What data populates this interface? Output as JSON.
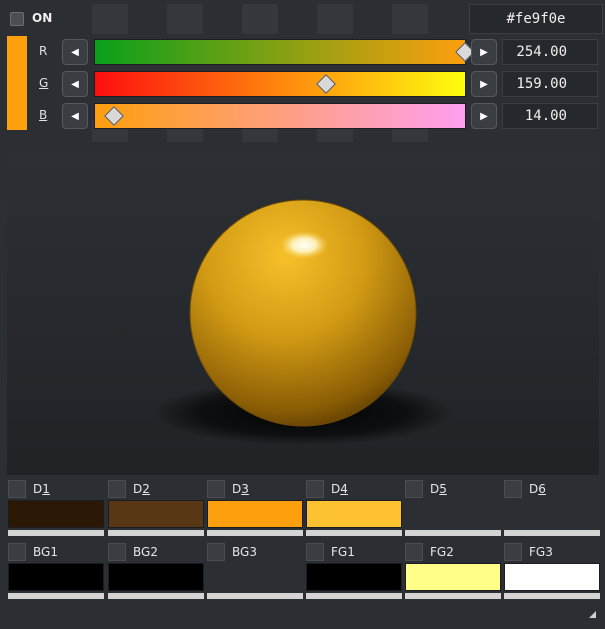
{
  "header": {
    "on_label": "ON",
    "hex": "#fe9f0e",
    "current_color": "#fe9f0e"
  },
  "channels": [
    {
      "label": "R",
      "underline": false,
      "value": "254.00",
      "fraction": 0.996
    },
    {
      "label": "G",
      "underline": true,
      "value": "159.00",
      "fraction": 0.624
    },
    {
      "label": "B",
      "underline": true,
      "value": "14.00",
      "fraction": 0.055
    }
  ],
  "tracks": {
    "r_gradient": [
      "#0aa01a",
      "#fe9f0e"
    ],
    "g_gradient": [
      "#fe0e0e",
      "#fefe0e"
    ],
    "b_gradient": [
      "#fe9f0e",
      "#fe9ff0"
    ]
  },
  "palette": {
    "row1": [
      {
        "label_pre": "D",
        "label_u": "1",
        "color": "#2a1805"
      },
      {
        "label_pre": "D",
        "label_u": "2",
        "color": "#573714"
      },
      {
        "label_pre": "D",
        "label_u": "3",
        "color": "#fe9f0e"
      },
      {
        "label_pre": "D",
        "label_u": "4",
        "color": "#fec230"
      },
      {
        "label_pre": "D",
        "label_u": "5",
        "color": "#2b2e33"
      },
      {
        "label_pre": "D",
        "label_u": "6",
        "color": "#2b2e33"
      }
    ],
    "row2": [
      {
        "label": "BG1",
        "color": "#000000"
      },
      {
        "label": "BG2",
        "color": "#000000"
      },
      {
        "label": "BG3",
        "color": "#2b2e33"
      },
      {
        "label": "FG1",
        "color": "#000000"
      },
      {
        "label": "FG2",
        "color": "#fefe88"
      },
      {
        "label": "FG3",
        "color": "#ffffff"
      }
    ]
  }
}
